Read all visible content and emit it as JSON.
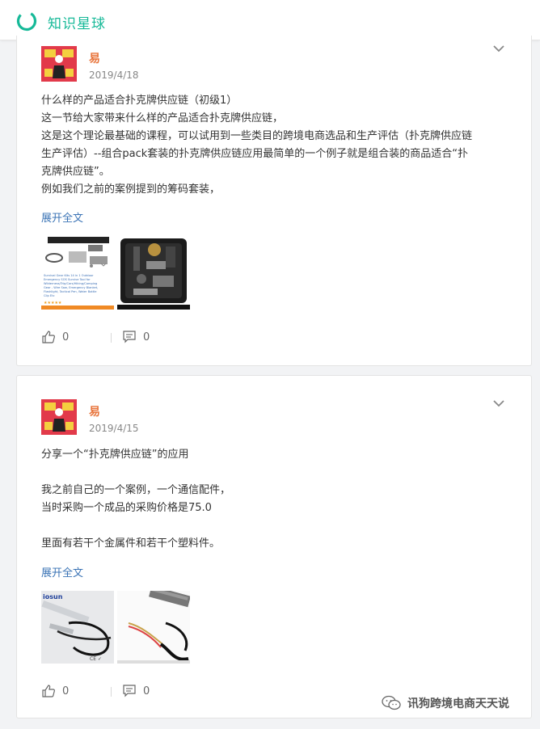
{
  "header": {
    "brand": "知识星球"
  },
  "posts": [
    {
      "author": "易",
      "date": "2019/4/18",
      "lines": [
        "什么样的产品适合扑克牌供应链（初级1）",
        "这一节给大家带来什么样的产品适合扑克牌供应链，",
        "这是这个理论最基础的课程，可以试用到一些类目的跨境电商选品和生产评估（扑克牌供应链",
        "生产评估）--组合pack套装的扑克牌供应链应用最简单的一个例子就是组合装的商品适合“扑",
        "克牌供应链”。",
        "例如我们之前的案例提到的筹码套装，"
      ],
      "expand": "展开全文",
      "thumb1_caption": "Survival Gear Kits 14 in 1 Outdoor Emergency SOS Survive Tool for Wilderness/Trip/Cars/Hiking/Camping Gear - Wire Saw, Emergency Blanket, Flashlight, Tactical Pen, Water Bottle Clip Etc",
      "likes": "0",
      "comments": "0"
    },
    {
      "author": "易",
      "date": "2019/4/15",
      "lines": [
        "分享一个“扑克牌供应链”的应用",
        "",
        "我之前自己的一个案例，一个通信配件，",
        "当时采购一个成品的采购价格是75.0",
        "",
        "里面有若干个金属件和若干个塑料件。"
      ],
      "expand": "展开全文",
      "thumb1_brand": "iosun",
      "likes": "0",
      "comments": "0"
    }
  ],
  "watermark": {
    "text": "讯狗跨境电商天天说"
  },
  "colors": {
    "brand": "#16b998",
    "author": "#e8743b",
    "link": "#3a73b5"
  }
}
